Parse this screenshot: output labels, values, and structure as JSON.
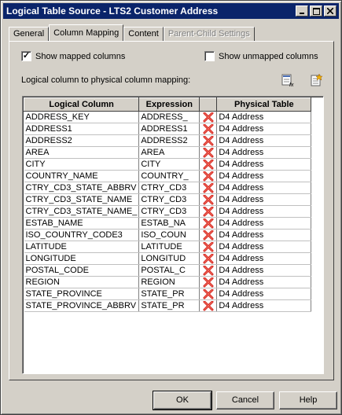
{
  "window": {
    "title": "Logical Table Source - LTS2 Customer Address",
    "minimize_label": "_",
    "maximize_label": "□",
    "close_label": "X"
  },
  "tabs": [
    {
      "label": "General",
      "state": "normal"
    },
    {
      "label": "Column Mapping",
      "state": "active"
    },
    {
      "label": "Content",
      "state": "normal"
    },
    {
      "label": "Parent-Child Settings",
      "state": "disabled"
    }
  ],
  "options": {
    "show_mapped": {
      "label": "Show mapped columns",
      "checked": true,
      "check_glyph": "✓"
    },
    "show_unmapped": {
      "label": "Show unmapped columns",
      "checked": false,
      "check_glyph": ""
    }
  },
  "mapping_label": "Logical column to physical column mapping:",
  "toolbar_icons": [
    "edit-expression-icon",
    "add-column-icon"
  ],
  "grid": {
    "headers": [
      "Logical Column",
      "Expression",
      "",
      "Physical Table"
    ],
    "rows": [
      {
        "logical": "ADDRESS_KEY",
        "expression": "ADDRESS_",
        "physical": "D4 Address"
      },
      {
        "logical": "ADDRESS1",
        "expression": "ADDRESS1",
        "physical": "D4 Address"
      },
      {
        "logical": "ADDRESS2",
        "expression": "ADDRESS2",
        "physical": "D4 Address"
      },
      {
        "logical": "AREA",
        "expression": "AREA",
        "physical": "D4 Address"
      },
      {
        "logical": "CITY",
        "expression": "CITY",
        "physical": "D4 Address"
      },
      {
        "logical": "COUNTRY_NAME",
        "expression": "COUNTRY_",
        "physical": "D4 Address"
      },
      {
        "logical": "CTRY_CD3_STATE_ABBRV",
        "expression": "CTRY_CD3",
        "physical": "D4 Address"
      },
      {
        "logical": "CTRY_CD3_STATE_NAME",
        "expression": "CTRY_CD3",
        "physical": "D4 Address"
      },
      {
        "logical": "CTRY_CD3_STATE_NAME_",
        "expression": "CTRY_CD3",
        "physical": "D4 Address"
      },
      {
        "logical": "ESTAB_NAME",
        "expression": "ESTAB_NA",
        "physical": "D4 Address"
      },
      {
        "logical": "ISO_COUNTRY_CODE3",
        "expression": "ISO_COUN",
        "physical": "D4 Address"
      },
      {
        "logical": "LATITUDE",
        "expression": "LATITUDE",
        "physical": "D4 Address"
      },
      {
        "logical": "LONGITUDE",
        "expression": "LONGITUD",
        "physical": "D4 Address"
      },
      {
        "logical": "POSTAL_CODE",
        "expression": "POSTAL_C",
        "physical": "D4 Address"
      },
      {
        "logical": "REGION",
        "expression": "REGION",
        "physical": "D4 Address"
      },
      {
        "logical": "STATE_PROVINCE",
        "expression": "STATE_PR",
        "physical": "D4 Address"
      },
      {
        "logical": "STATE_PROVINCE_ABBRV",
        "expression": "STATE_PR",
        "physical": "D4 Address"
      }
    ],
    "delete_icon": "red-x-delete-icon"
  },
  "buttons": {
    "ok": "OK",
    "cancel": "Cancel",
    "help": "Help"
  },
  "colors": {
    "titlebar": "#0a246a",
    "face": "#d4d0c8",
    "delete_x": "#d4231c"
  }
}
